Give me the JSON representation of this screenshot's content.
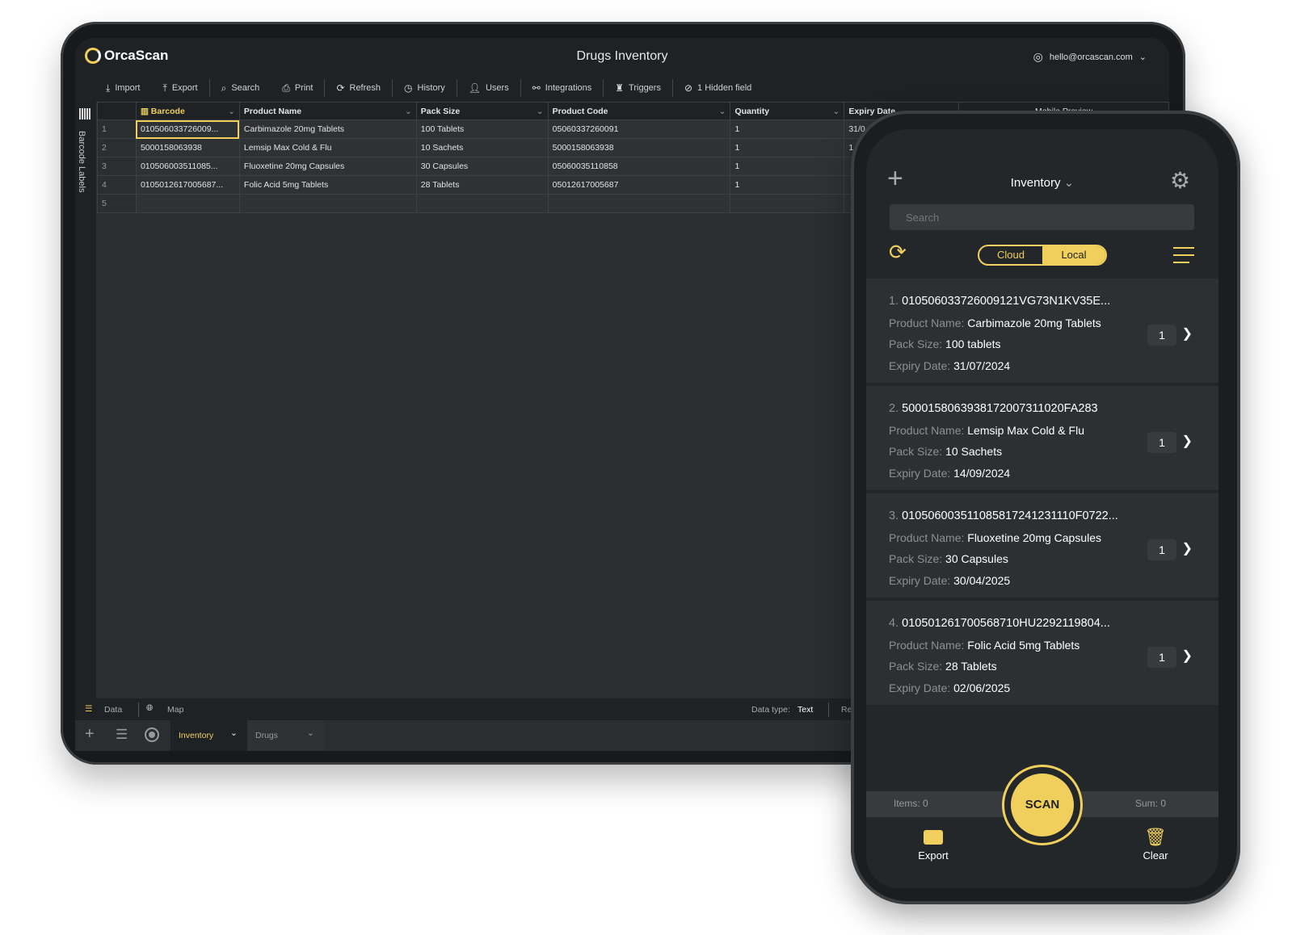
{
  "app": {
    "brand": "OrcaScan",
    "title": "Drugs Inventory",
    "user_email": "hello@orcascan.com"
  },
  "toolbar": [
    {
      "icon": "download-icon",
      "label": "Import"
    },
    {
      "icon": "upload-icon",
      "label": "Export"
    },
    {
      "icon": "search-icon",
      "label": "Search"
    },
    {
      "icon": "printer-icon",
      "label": "Print"
    },
    {
      "icon": "refresh-icon",
      "label": "Refresh"
    },
    {
      "icon": "history-icon",
      "label": "History"
    },
    {
      "icon": "users-icon",
      "label": "Users"
    },
    {
      "icon": "integrations-icon",
      "label": "Integrations"
    },
    {
      "icon": "robot-icon",
      "label": "Triggers"
    },
    {
      "icon": "eye-off-icon",
      "label": "1 Hidden field"
    }
  ],
  "side_label": "Barcode Labels",
  "grid": {
    "columns": [
      "Barcode",
      "Product Name",
      "Pack Size",
      "Product Code",
      "Quantity",
      "Expiry Date",
      "Mobile Preview"
    ],
    "rows": [
      {
        "n": "1",
        "barcode": "010506033726009...",
        "name": "Carbimazole 20mg Tablets",
        "pack": "100 Tablets",
        "code": "05060337260091",
        "qty": "1",
        "expiry": "31/0"
      },
      {
        "n": "2",
        "barcode": "5000158063938",
        "name": "Lemsip Max Cold & Flu",
        "pack": "10 Sachets",
        "code": "5000158063938",
        "qty": "1",
        "expiry": "1"
      },
      {
        "n": "3",
        "barcode": "010506003511085...",
        "name": "Fluoxetine 20mg Capsules",
        "pack": "30 Capsules",
        "code": "05060035110858",
        "qty": "1",
        "expiry": ""
      },
      {
        "n": "4",
        "barcode": "0105012617005687...",
        "name": "Folic Acid 5mg Tablets",
        "pack": "28 Tablets",
        "code": "05012617005687",
        "qty": "1",
        "expiry": ""
      },
      {
        "n": "5",
        "barcode": "",
        "name": "",
        "pack": "",
        "code": "",
        "qty": "",
        "expiry": ""
      }
    ]
  },
  "status": {
    "data_tab": "Data",
    "map_tab": "Map",
    "data_type_label": "Data type:",
    "data_type_value": "Text",
    "right_cut": "Re"
  },
  "sheet_tabs": {
    "active": "Inventory",
    "other": "Drugs"
  },
  "phone": {
    "sheet": "Inventory",
    "search_placeholder": "Search",
    "toggle": [
      "Cloud",
      "Local"
    ],
    "active_toggle": "Local",
    "labels": {
      "name": "Product Name:",
      "pack": "Pack Size:",
      "expiry": "Expiry Date:"
    },
    "items": [
      {
        "index": "1.",
        "barcode": "010506033726009121VG73N1KV35E...",
        "name": "Carbimazole 20mg Tablets",
        "pack": "100 tablets",
        "expiry": "31/07/2024",
        "qty": "1"
      },
      {
        "index": "2.",
        "barcode": "5000158063938172007311020FA283",
        "name": "Lemsip Max Cold & Flu",
        "pack": "10 Sachets",
        "expiry": "14/09/2024",
        "qty": "1"
      },
      {
        "index": "3.",
        "barcode": "010506003511085817241231110F0722...",
        "name": "Fluoxetine 20mg Capsules",
        "pack": "30 Capsules",
        "expiry": "30/04/2025",
        "qty": "1"
      },
      {
        "index": "4.",
        "barcode": "010501261700568710HU2292119804...",
        "name": "Folic Acid 5mg Tablets",
        "pack": "28 Tablets",
        "expiry": "02/06/2025",
        "qty": "1"
      }
    ],
    "items_count": "Items: 0",
    "sum": "Sum: 0",
    "scan": "SCAN",
    "export": "Export",
    "clear": "Clear"
  },
  "colors": {
    "accent": "#f0cf5c",
    "bg": "#2b2e31",
    "header": "#1f2225"
  }
}
